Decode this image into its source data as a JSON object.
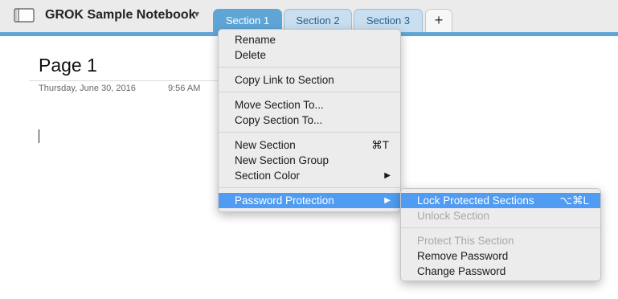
{
  "notebook": {
    "title": "GROK Sample Notebook",
    "chevron": "▼"
  },
  "tabs": [
    {
      "label": "Section 1",
      "active": true
    },
    {
      "label": "Section 2",
      "active": false
    },
    {
      "label": "Section 3",
      "active": false
    }
  ],
  "add_tab_label": "+",
  "page": {
    "title": "Page 1",
    "date": "Thursday, June 30, 2016",
    "time": "9:56 AM"
  },
  "context_menu": {
    "rename": "Rename",
    "delete": "Delete",
    "copy_link": "Copy Link to Section",
    "move_section": "Move Section To...",
    "copy_section": "Copy Section To...",
    "new_section": "New Section",
    "new_section_shortcut": "⌘T",
    "new_section_group": "New Section Group",
    "section_color": "Section Color",
    "password_protection": "Password Protection",
    "submenu_arrow": "▶"
  },
  "password_submenu": {
    "lock": "Lock Protected Sections",
    "lock_shortcut": "⌥⌘L",
    "unlock": "Unlock Section",
    "protect": "Protect This Section",
    "remove": "Remove Password",
    "change": "Change Password"
  },
  "colors": {
    "accent": "#5fa6d6",
    "menu_highlight": "#4f9cf2",
    "tab_inactive": "#c9dff0"
  }
}
